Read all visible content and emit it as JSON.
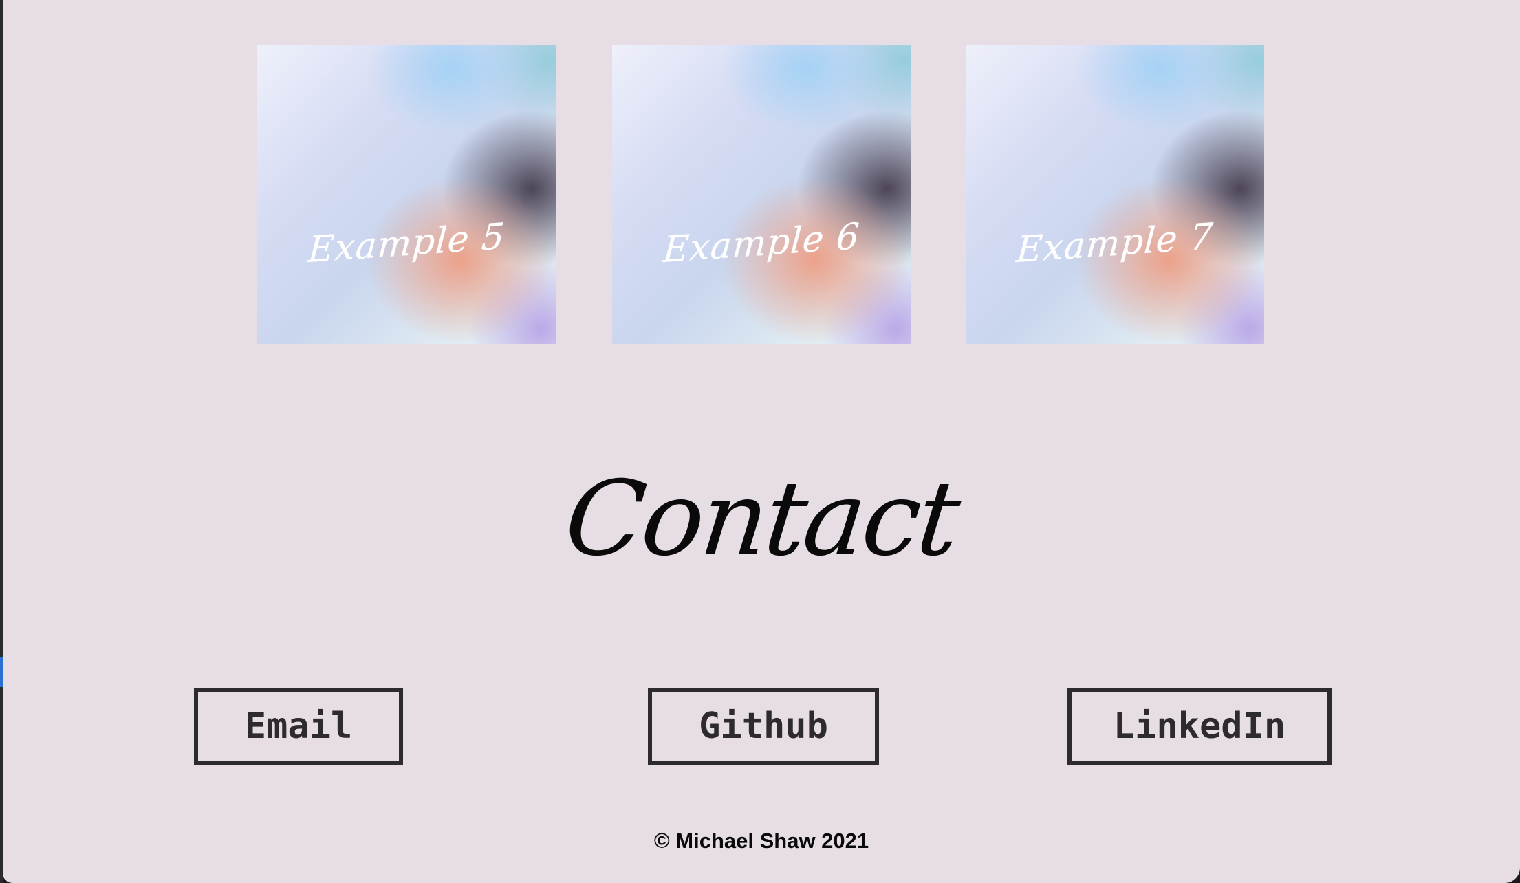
{
  "gallery": {
    "cards": [
      {
        "label": "Example 5"
      },
      {
        "label": "Example 6"
      },
      {
        "label": "Example 7"
      }
    ]
  },
  "contact": {
    "title": "Contact",
    "buttons": {
      "email": "Email",
      "github": "Github",
      "linkedin": "LinkedIn"
    }
  },
  "footer": {
    "copyright": "© Michael Shaw 2021"
  },
  "colors": {
    "background": "#e6dee4",
    "text": "#0a0a0a",
    "button_border": "#2d2b2d"
  }
}
